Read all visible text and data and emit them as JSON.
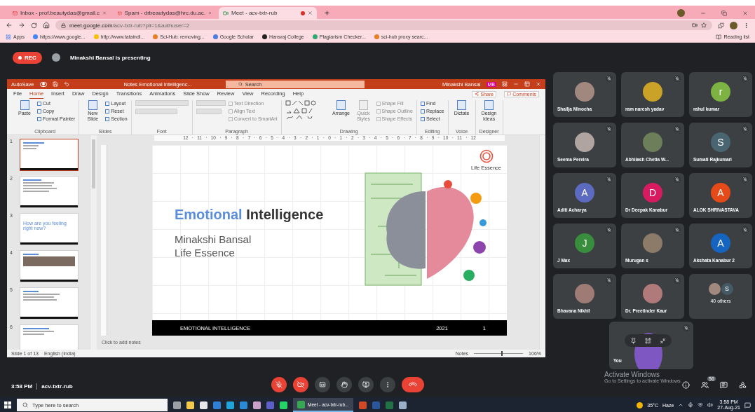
{
  "browser": {
    "tabs": [
      {
        "title": "Inbox - prof.beautydas@gmail.c",
        "kind": "mail",
        "selected": false,
        "recording": false
      },
      {
        "title": "Spam - drbeautydas@hrc.du.ac.",
        "kind": "mail",
        "selected": false,
        "recording": false
      },
      {
        "title": "Meet - acv-txtr-rub",
        "kind": "meet",
        "selected": true,
        "recording": true
      }
    ],
    "url_host": "meet.google.com",
    "url_path": "/acv-txtr-rub?pli=1&authuser=2",
    "apps_label": "Apps",
    "bookmarks": [
      {
        "label": "https://www.google...",
        "color": "#4285f4"
      },
      {
        "label": "http://www.tataindi...",
        "color": "#f4c20d"
      },
      {
        "label": "Sci-Hub: removing...",
        "color": "#e67e22"
      },
      {
        "label": "Google Scholar",
        "color": "#4a7ee0"
      },
      {
        "label": "Hansraj College",
        "color": "#222222"
      },
      {
        "label": "Plagiarism Checker...",
        "color": "#2eaa6e"
      },
      {
        "label": "sci-hub proxy searc...",
        "color": "#e67e22"
      }
    ],
    "reading_list": "Reading list"
  },
  "meet": {
    "rec": "REC",
    "presenter": "Minakshi Bansal is presenting",
    "time": "3:58 PM",
    "meeting_code": "acv-txtr-rub",
    "controls": [
      {
        "kind": "mic",
        "off": true
      },
      {
        "kind": "camera",
        "off": true
      },
      {
        "kind": "captions",
        "off": false
      },
      {
        "kind": "hand",
        "off": false
      },
      {
        "kind": "present",
        "off": false
      },
      {
        "kind": "more",
        "off": false
      },
      {
        "kind": "hangup"
      }
    ],
    "side_icons": [
      {
        "kind": "info"
      },
      {
        "kind": "people",
        "badge": "56"
      },
      {
        "kind": "chat"
      },
      {
        "kind": "activities"
      }
    ],
    "participants": [
      {
        "name": "Shailja Minocha",
        "kind": "photo",
        "color": "#a1887f",
        "muted": true
      },
      {
        "name": "ram naresh yadav",
        "kind": "photo",
        "color": "#c9a227",
        "muted": true
      },
      {
        "name": "rahul kumar",
        "kind": "letter",
        "initial": "r",
        "color": "#7cb342",
        "muted": true
      },
      {
        "name": "Seema Pereira",
        "kind": "photo",
        "color": "#b0a4a0",
        "muted": true
      },
      {
        "name": "Abhilash Chetia W...",
        "kind": "photo",
        "color": "#6d7f5a",
        "muted": true
      },
      {
        "name": "Sumati Rajkumari",
        "kind": "letter",
        "initial": "S",
        "color": "#4a6572",
        "muted": true
      },
      {
        "name": "Aditi Acharya",
        "kind": "letter",
        "initial": "A",
        "color": "#5c6bc0",
        "muted": true
      },
      {
        "name": "Dr Deepak Kanabur",
        "kind": "letter",
        "initial": "D",
        "color": "#d81b60",
        "muted": true
      },
      {
        "name": "ALOK SHRIVASTAVA",
        "kind": "letter",
        "initial": "A",
        "color": "#e64a19",
        "muted": true
      },
      {
        "name": "J Max",
        "kind": "letter",
        "initial": "J",
        "color": "#388e3c",
        "muted": true
      },
      {
        "name": "Murugan s",
        "kind": "photo",
        "color": "#8d7b6a",
        "muted": true
      },
      {
        "name": "Akshata Kanabur 2",
        "kind": "letter",
        "initial": "A",
        "color": "#1565c0",
        "muted": true
      },
      {
        "name": "Bhavana Nikhil",
        "kind": "photo",
        "color": "#9e7b74",
        "muted": true
      },
      {
        "name": "Dr. Preetinder Kaur",
        "kind": "photo",
        "color": "#b07a7a",
        "muted": true
      }
    ],
    "others": {
      "label": "40 others",
      "initial": "S",
      "color": "#455a64"
    },
    "self": {
      "name": "You",
      "color": "#7e57c2",
      "muted": true
    },
    "activation": {
      "title": "Activate Windows",
      "hint": "Go to Settings to activate Windows."
    }
  },
  "powerpoint": {
    "autosave": "AutoSave",
    "autosave_on": false,
    "doc_title": "Notes Emotional Intelligenc...",
    "search": "Search",
    "user": "Minakshi Bansal",
    "user_initials": "MB",
    "tabs": [
      {
        "label": "File",
        "selected": false
      },
      {
        "label": "Home",
        "selected": true
      },
      {
        "label": "Insert",
        "selected": false
      },
      {
        "label": "Draw",
        "selected": false
      },
      {
        "label": "Design",
        "selected": false
      },
      {
        "label": "Transitions",
        "selected": false
      },
      {
        "label": "Animations",
        "selected": false
      },
      {
        "label": "Slide Show",
        "selected": false
      },
      {
        "label": "Review",
        "selected": false
      },
      {
        "label": "View",
        "selected": false
      },
      {
        "label": "Recording",
        "selected": false
      },
      {
        "label": "Help",
        "selected": false
      }
    ],
    "share": "Share",
    "comments": "Comments",
    "groups": [
      {
        "label": "Clipboard",
        "kind": "plain",
        "items": [
          {
            "label": "Paste",
            "kind": "large",
            "disabled": false
          },
          {
            "label": "Cut",
            "kind": "small",
            "disabled": false
          },
          {
            "label": "Copy",
            "kind": "small",
            "disabled": false
          },
          {
            "label": "Format Painter",
            "kind": "small",
            "disabled": false
          }
        ]
      },
      {
        "label": "Slides",
        "kind": "plain",
        "items": [
          {
            "label": "New Slide",
            "kind": "large",
            "disabled": false
          },
          {
            "label": "Layout",
            "kind": "small",
            "disabled": false
          },
          {
            "label": "Reset",
            "kind": "small",
            "disabled": false
          },
          {
            "label": "Section",
            "kind": "small",
            "disabled": false
          }
        ]
      },
      {
        "label": "Font",
        "kind": "font"
      },
      {
        "label": "Paragraph",
        "kind": "paragraph",
        "items": [
          {
            "label": "Text Direction",
            "kind": "small",
            "disabled": true
          },
          {
            "label": "Align Text",
            "kind": "small",
            "disabled": true
          },
          {
            "label": "Convert to SmartArt",
            "kind": "small",
            "disabled": true
          }
        ]
      },
      {
        "label": "Drawing",
        "kind": "shapes",
        "items": [
          {
            "label": "Arrange",
            "kind": "large",
            "disabled": false
          },
          {
            "label": "Quick Styles",
            "kind": "large",
            "disabled": true
          },
          {
            "label": "Shape Fill",
            "kind": "small",
            "disabled": true
          },
          {
            "label": "Shape Outline",
            "kind": "small",
            "disabled": true
          },
          {
            "label": "Shape Effects",
            "kind": "small",
            "disabled": true
          }
        ]
      },
      {
        "label": "Editing",
        "kind": "plain",
        "items": [
          {
            "label": "Find",
            "kind": "small",
            "disabled": false
          },
          {
            "label": "Replace",
            "kind": "small",
            "disabled": false
          },
          {
            "label": "Select",
            "kind": "small",
            "disabled": false
          }
        ]
      },
      {
        "label": "Voice",
        "kind": "plain",
        "items": [
          {
            "label": "Dictate",
            "kind": "large",
            "disabled": false
          }
        ]
      },
      {
        "label": "Designer",
        "kind": "plain",
        "items": [
          {
            "label": "Design Ideas",
            "kind": "large",
            "disabled": false
          }
        ]
      }
    ],
    "ruler": "12 · 11 · 10 · 9 · 8 · 7 · 6 · 5 · 4 · 3 · 2 · 1 · 0 · 1 · 2 · 3 · 4 · 5 · 6 · 7 · 8 · 9 · 10 · 11 · 12",
    "thumbnails": [
      {
        "number": "1",
        "kind": "title",
        "selected": true
      },
      {
        "number": "2",
        "kind": "list",
        "selected": false
      },
      {
        "number": "3",
        "kind": "question",
        "caption": "How are you feeling right now?",
        "selected": false
      },
      {
        "number": "4",
        "kind": "photos",
        "selected": false
      },
      {
        "number": "5",
        "kind": "icons",
        "selected": false
      },
      {
        "number": "6",
        "kind": "text",
        "selected": false
      }
    ],
    "slide": {
      "title_accent": "Emotional",
      "title_main": "Intelligence",
      "subtitle": [
        "Minakshi Bansal",
        "Life Essence"
      ],
      "logo_text": "Life Essence",
      "footer": "EMOTIONAL INTELLIGENCE",
      "year": "2021",
      "page": "1"
    },
    "notes_placeholder": "Click to add notes",
    "status": {
      "slide": "Slide 1 of 13",
      "language": "English (India)",
      "notes": "Notes",
      "zoom": "106%",
      "zoom_slider": {
        "level": 0.55
      }
    }
  },
  "taskbar": {
    "search": "Type here to search",
    "active_app": "Meet - acv-txtr-rub...",
    "apps_before": [
      {
        "color": "#9aa0a6"
      },
      {
        "color": "#f2c94c"
      },
      {
        "color": "#e8e8e8"
      },
      {
        "color": "#2f7fd6"
      },
      {
        "color": "#1fa3d8"
      },
      {
        "color": "#2a8ad8"
      },
      {
        "color": "#c8a2c8"
      },
      {
        "color": "#5b5fc7"
      },
      {
        "color": "#25d366"
      }
    ],
    "apps_after": [
      {
        "color": "#d24726"
      },
      {
        "color": "#2b579a"
      },
      {
        "color": "#217346"
      },
      {
        "color": "#9ab0c8"
      }
    ],
    "temperature": "35°C",
    "weather": "Haze",
    "time": "3:58 PM",
    "date": "27-Aug-21"
  }
}
